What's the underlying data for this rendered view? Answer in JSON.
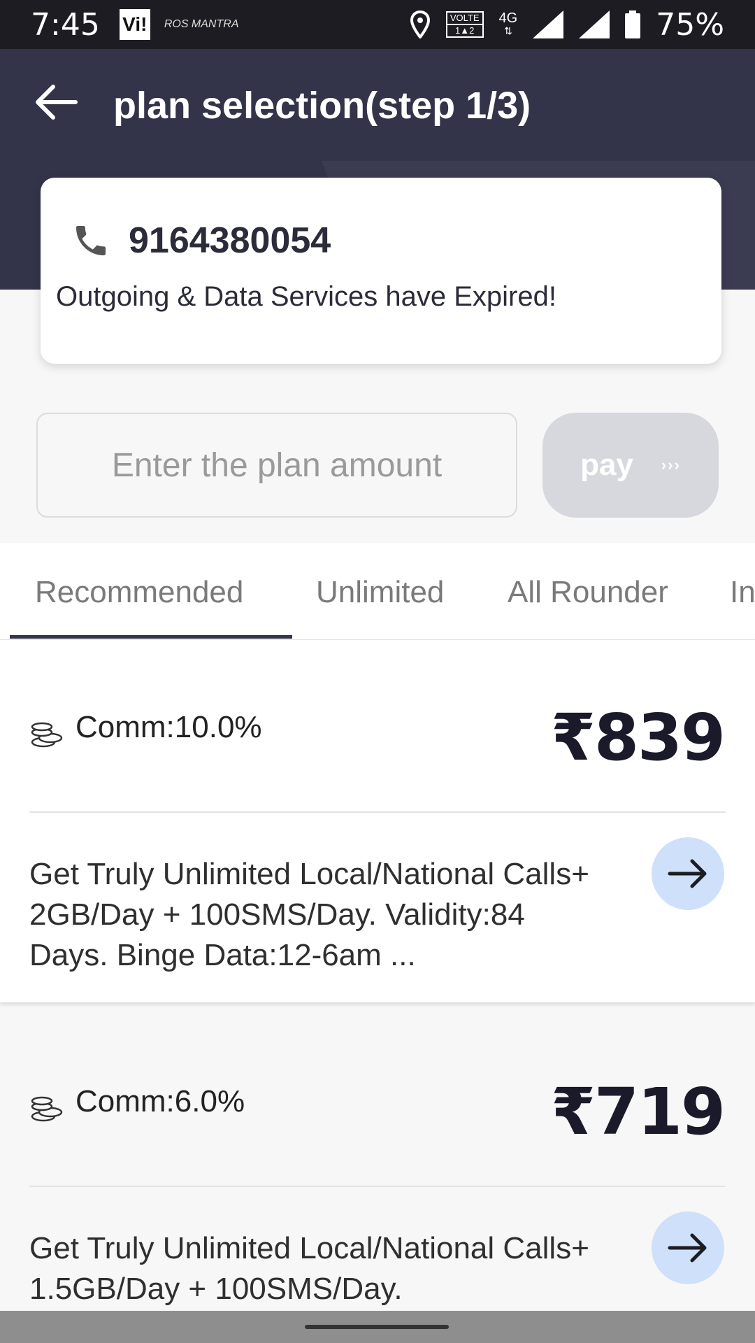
{
  "status_bar": {
    "time": "7:45",
    "carrier_logo": "Vi!",
    "app_logo": "ROS MANTRA",
    "volte_label": "VOLTE",
    "volte_sub": "1▲2",
    "network_label": "4G",
    "battery": "75%",
    "icons": [
      "location-icon",
      "signal-icon",
      "signal-icon",
      "battery-icon"
    ]
  },
  "header": {
    "title": "plan selection(step 1/3)",
    "back_icon": "back-arrow-icon",
    "bg_color": "#333449"
  },
  "account_card": {
    "phone_icon": "phone-icon",
    "phone_number": "9164380054",
    "status_message": "Outgoing & Data Services have Expired!"
  },
  "amount_entry": {
    "placeholder": "Enter the plan amount",
    "value": "",
    "pay_label": "pay",
    "pay_chevrons": "›››"
  },
  "tabs": [
    {
      "label": "Recommended",
      "active": true
    },
    {
      "label": "Unlimited",
      "active": false
    },
    {
      "label": "All Rounder",
      "active": false
    },
    {
      "label": "In",
      "active": false
    }
  ],
  "plans": [
    {
      "commission": "Comm:10.0%",
      "price": "₹839",
      "description": "Get Truly Unlimited Local/National Calls+ 2GB/Day + 100SMS/Day. Validity:84 Days. Binge Data:12-6am ..."
    },
    {
      "commission": "Comm:6.0%",
      "price": "₹719",
      "description": "Get Truly Unlimited Local/National Calls+ 1.5GB/Day + 100SMS/Day."
    }
  ],
  "colors": {
    "header": "#333449",
    "accent_button": "#cfe0fb",
    "pay_disabled": "#d7d7de"
  }
}
